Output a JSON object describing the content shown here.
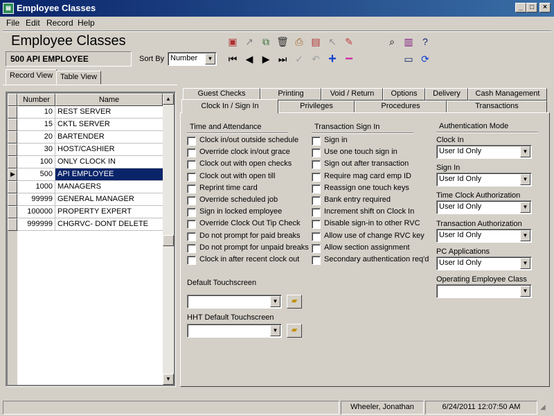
{
  "window": {
    "title": "Employee Classes",
    "app_icon": "app-icon",
    "controls": [
      "minimize-icon",
      "maximize-icon",
      "close-icon"
    ]
  },
  "menu": {
    "items": [
      "File",
      "Edit",
      "Record",
      "Help"
    ]
  },
  "header": {
    "title": "Employee Classes",
    "current_record": "500 API EMPLOYEE",
    "sort_by_label": "Sort By",
    "sort_by_value": "Number"
  },
  "view_tabs": [
    "Record View",
    "Table View"
  ],
  "grid": {
    "columns": [
      "Number",
      "Name"
    ],
    "rows": [
      {
        "number": "10",
        "name": "REST SERVER"
      },
      {
        "number": "15",
        "name": "CKTL SERVER"
      },
      {
        "number": "20",
        "name": "BARTENDER"
      },
      {
        "number": "30",
        "name": "HOST/CASHIER"
      },
      {
        "number": "100",
        "name": "ONLY CLOCK IN"
      },
      {
        "number": "500",
        "name": "API EMPLOYEE"
      },
      {
        "number": "1000",
        "name": "MANAGERS"
      },
      {
        "number": "99999",
        "name": "GENERAL MANAGER"
      },
      {
        "number": "100000",
        "name": "PROPERTY EXPERT"
      },
      {
        "number": "999999",
        "name": "CHGRVC- DONT DELETE"
      }
    ],
    "selected_index": 5
  },
  "panel_tabs_top": [
    "Guest Checks",
    "Printing",
    "Void / Return",
    "Options",
    "Delivery",
    "Cash Management"
  ],
  "panel_tabs_bottom": [
    "Clock In / Sign In",
    "Privileges",
    "Procedures",
    "Transactions"
  ],
  "time_attendance": {
    "title": "Time and Attendance",
    "items": [
      "Clock in/out outside schedule",
      "Override clock in/out grace",
      "Clock out with open checks",
      "Clock out with open till",
      "Reprint time card",
      "Override scheduled job",
      "Sign in locked employee",
      "Override Clock Out Tip Check",
      "Do not prompt for paid breaks",
      "Do not prompt for unpaid breaks",
      "Clock in after recent clock out"
    ]
  },
  "transaction_signin": {
    "title": "Transaction Sign In",
    "items": [
      "Sign in",
      "Use one touch sign in",
      "Sign out after transaction",
      "Require mag card emp ID",
      "Reassign one touch keys",
      "Bank entry required",
      "Increment shift on Clock In",
      "Disable sign-in to other RVC",
      "Allow use of change RVC key",
      "Allow section assignment",
      "Secondary authentication req'd"
    ]
  },
  "auth_mode": {
    "title": "Authentication Mode",
    "fields": [
      {
        "label": "Clock In",
        "value": "User Id Only"
      },
      {
        "label": "Sign In",
        "value": "User Id Only"
      },
      {
        "label": "Time Clock Authorization",
        "value": "User Id Only"
      },
      {
        "label": "Transaction Authorization",
        "value": "User Id Only"
      },
      {
        "label": "PC Applications",
        "value": "User Id Only"
      },
      {
        "label": "Operating Employee Class",
        "value": ""
      }
    ]
  },
  "touchscreens": {
    "default_label": "Default Touchscreen",
    "default_value": "",
    "hht_label": "HHT Default Touchscreen",
    "hht_value": ""
  },
  "status_bar": {
    "user": "Wheeler, Jonathan",
    "datetime": "6/24/2011 12:07:50 AM"
  }
}
